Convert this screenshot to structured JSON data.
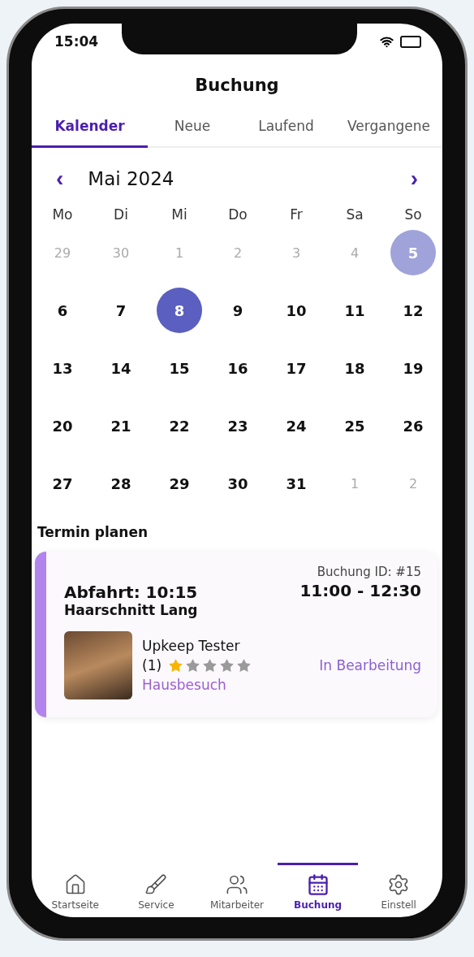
{
  "status_bar": {
    "time": "15:04"
  },
  "header": {
    "title": "Buchung"
  },
  "tabs": [
    {
      "label": "Kalender",
      "selected": true
    },
    {
      "label": "Neue",
      "selected": false
    },
    {
      "label": "Laufend",
      "selected": false
    },
    {
      "label": "Vergangene",
      "selected": false
    }
  ],
  "calendar": {
    "month": "Mai 2024",
    "prev": "‹",
    "next": "›",
    "weekdays": [
      "Mo",
      "Di",
      "Mi",
      "Do",
      "Fr",
      "Sa",
      "So"
    ],
    "weeks": [
      [
        {
          "day": "29",
          "muted": true,
          "selected": false,
          "today": false
        },
        {
          "day": "30",
          "muted": true,
          "selected": false,
          "today": false
        },
        {
          "day": "1",
          "muted": true,
          "selected": false,
          "today": false
        },
        {
          "day": "2",
          "muted": true,
          "selected": false,
          "today": false
        },
        {
          "day": "3",
          "muted": true,
          "selected": false,
          "today": false
        },
        {
          "day": "4",
          "muted": true,
          "selected": false,
          "today": false
        },
        {
          "day": "5",
          "muted": false,
          "selected": false,
          "today": true
        }
      ],
      [
        {
          "day": "6",
          "muted": false,
          "selected": false,
          "today": false
        },
        {
          "day": "7",
          "muted": false,
          "selected": false,
          "today": false
        },
        {
          "day": "8",
          "muted": false,
          "selected": true,
          "today": false
        },
        {
          "day": "9",
          "muted": false,
          "selected": false,
          "today": false
        },
        {
          "day": "10",
          "muted": false,
          "selected": false,
          "today": false
        },
        {
          "day": "11",
          "muted": false,
          "selected": false,
          "today": false
        },
        {
          "day": "12",
          "muted": false,
          "selected": false,
          "today": false
        }
      ],
      [
        {
          "day": "13",
          "muted": false,
          "selected": false,
          "today": false
        },
        {
          "day": "14",
          "muted": false,
          "selected": false,
          "today": false
        },
        {
          "day": "15",
          "muted": false,
          "selected": false,
          "today": false
        },
        {
          "day": "16",
          "muted": false,
          "selected": false,
          "today": false
        },
        {
          "day": "17",
          "muted": false,
          "selected": false,
          "today": false
        },
        {
          "day": "18",
          "muted": false,
          "selected": false,
          "today": false
        },
        {
          "day": "19",
          "muted": false,
          "selected": false,
          "today": false
        }
      ],
      [
        {
          "day": "20",
          "muted": false,
          "selected": false,
          "today": false
        },
        {
          "day": "21",
          "muted": false,
          "selected": false,
          "today": false
        },
        {
          "day": "22",
          "muted": false,
          "selected": false,
          "today": false
        },
        {
          "day": "23",
          "muted": false,
          "selected": false,
          "today": false
        },
        {
          "day": "24",
          "muted": false,
          "selected": false,
          "today": false
        },
        {
          "day": "25",
          "muted": false,
          "selected": false,
          "today": false
        },
        {
          "day": "26",
          "muted": false,
          "selected": false,
          "today": false
        }
      ],
      [
        {
          "day": "27",
          "muted": false,
          "selected": false,
          "today": false
        },
        {
          "day": "28",
          "muted": false,
          "selected": false,
          "today": false
        },
        {
          "day": "29",
          "muted": false,
          "selected": false,
          "today": false
        },
        {
          "day": "30",
          "muted": false,
          "selected": false,
          "today": false
        },
        {
          "day": "31",
          "muted": false,
          "selected": false,
          "today": false
        },
        {
          "day": "1",
          "muted": true,
          "selected": false,
          "today": false
        },
        {
          "day": "2",
          "muted": true,
          "selected": false,
          "today": false
        }
      ]
    ]
  },
  "section_title": "Termin planen",
  "booking": {
    "id": "Buchung ID: #15",
    "departure": "Abfahrt: 10:15",
    "time": "11:00 - 12:30",
    "service": "Haarschnitt Lang",
    "customer": "Upkeep Tester",
    "rating_count": "(1)",
    "stars": 1,
    "visit_type": "Hausbesuch",
    "status": "In Bearbeitung"
  },
  "bottom_nav": [
    {
      "label": "Startseite",
      "kind": "home",
      "selected": false
    },
    {
      "label": "Service",
      "kind": "brush",
      "selected": false
    },
    {
      "label": "Mitarbeiter",
      "kind": "people",
      "selected": false
    },
    {
      "label": "Buchung",
      "kind": "calendar",
      "selected": true
    },
    {
      "label": "Einstell",
      "kind": "gear",
      "selected": false
    }
  ]
}
